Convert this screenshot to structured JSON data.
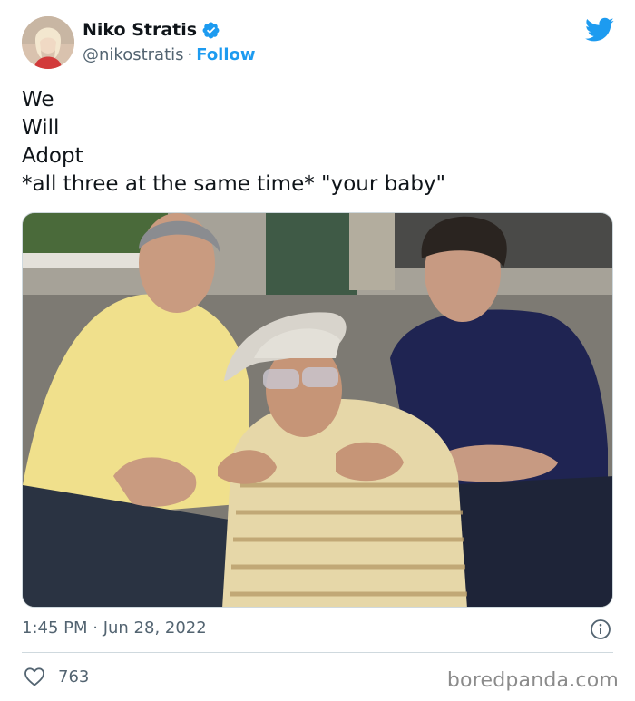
{
  "author": {
    "name": "Niko Stratis",
    "handle": "@nikostratis",
    "separator": "·",
    "follow_label": "Follow",
    "verified": true
  },
  "tweet": {
    "lines": [
      "We",
      "Will",
      "Adopt",
      "*all three at the same time* \"your baby\""
    ]
  },
  "meta": {
    "timestamp": "1:45 PM · Jun 28, 2022"
  },
  "engagement": {
    "likes": "763"
  },
  "watermark": "boredpanda.com",
  "colors": {
    "accent": "#1d9bf0",
    "text": "#0f1419",
    "secondary": "#536471",
    "border": "#cfd9de"
  },
  "icons": {
    "brand": "twitter-bird-icon",
    "verified": "verified-badge-icon",
    "info": "info-icon",
    "like": "heart-icon"
  }
}
